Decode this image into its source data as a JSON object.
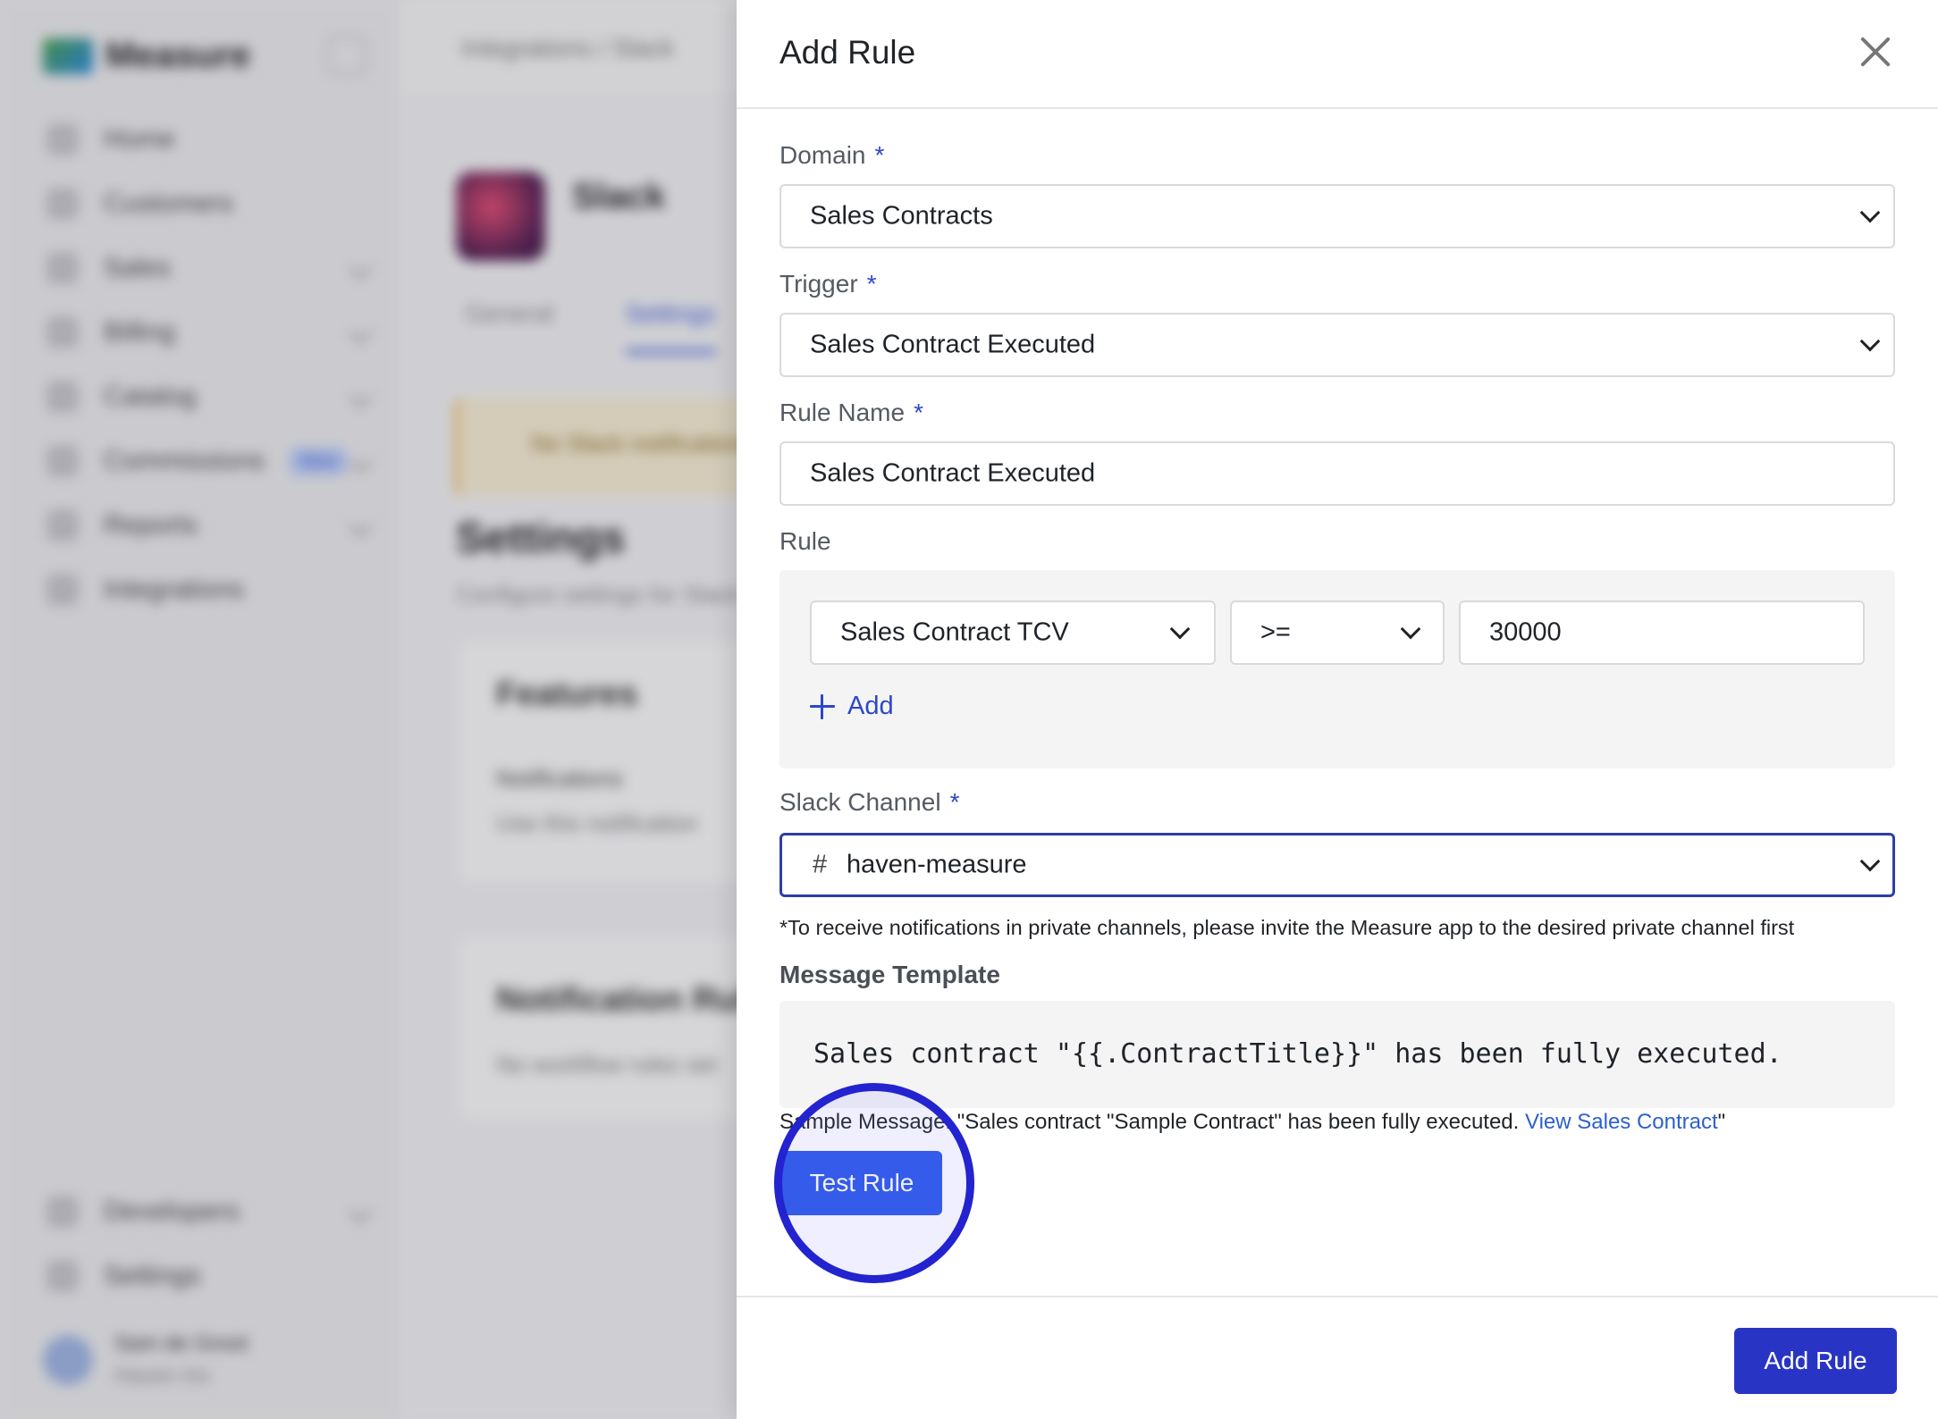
{
  "background": {
    "brand": "Measure",
    "nav_items": [
      "Home",
      "Customers",
      "Sales",
      "Billing",
      "Catalog",
      "Commissions",
      "Reports",
      "Integrations"
    ],
    "nav_badge": "New",
    "nav_bottom": [
      "Developers",
      "Settings"
    ],
    "user_name": "Sam de Groot",
    "user_org": "Haven Inc",
    "breadcrumb": "Integrations / Slack",
    "app_title": "Slack",
    "tabs": [
      "General",
      "Settings"
    ],
    "alert_text": "No Slack notifications",
    "settings_heading": "Settings",
    "settings_sub": "Configure settings for Slack",
    "features_heading": "Features",
    "features_item": "Notifications",
    "features_item_desc": "Use this notification",
    "rules_heading": "Notification Rules",
    "rules_desc": "No workflow rules set"
  },
  "drawer": {
    "title": "Add Rule",
    "required_mark": "*",
    "domain": {
      "label": "Domain",
      "value": "Sales Contracts"
    },
    "trigger": {
      "label": "Trigger",
      "value": "Sales Contract Executed"
    },
    "rule_name": {
      "label": "Rule Name",
      "value": "Sales Contract Executed"
    },
    "rule": {
      "label": "Rule",
      "field": "Sales Contract TCV",
      "operator": ">=",
      "value": "30000",
      "add_label": "Add"
    },
    "slack_channel": {
      "label": "Slack Channel",
      "prefix": "#",
      "value": "haven-measure"
    },
    "note": "*To receive notifications in private channels, please invite the Measure app to the desired private channel first",
    "message_template": {
      "label": "Message Template",
      "value": "Sales contract \"{{.ContractTitle}}\" has been fully executed."
    },
    "sample": {
      "prefix": "Sample Message: \"Sales contract \"Sample Contract\" has been fully executed. ",
      "link": "View Sales Contract",
      "suffix": "\""
    },
    "test_button": "Test Rule",
    "submit_button": "Add Rule"
  },
  "colors": {
    "primary": "#2b57e6",
    "submit": "#2835c4",
    "required": "#2d47c7",
    "highlight_ring": "#2323d0"
  }
}
